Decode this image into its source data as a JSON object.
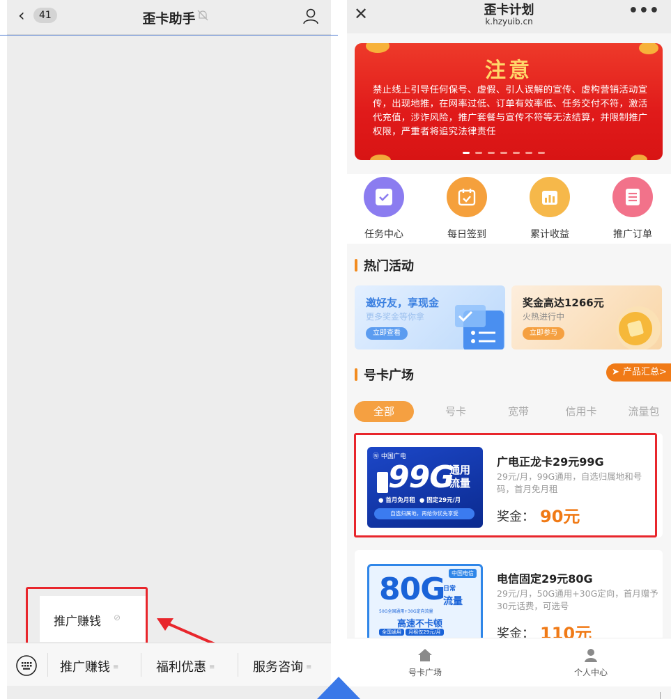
{
  "chat": {
    "back_count": "41",
    "title": "歪卡助手",
    "popup": {
      "label": "推广赚钱",
      "link_icon": "link-icon"
    },
    "menu": [
      {
        "label": "推广赚钱"
      },
      {
        "label": "福利优惠"
      },
      {
        "label": "服务咨询"
      }
    ],
    "menu_lines_glyph": "≡"
  },
  "webview": {
    "title": "歪卡计划",
    "url": "k.hzyuib.cn",
    "banner": {
      "title": "注意",
      "text": "禁止线上引导任何保号、虚假、引人误解的宣传、虚构营销活动宣传，出现地推，在网率过低、订单有效率低、任务交付不符，激活代充值，涉诈风险，推广套餐与宣传不符等无法结算，并限制推广权限，严重者将追究法律责任"
    },
    "quick_actions": [
      {
        "label": "任务中心",
        "icon": "task-icon",
        "color": "#8b7cf0"
      },
      {
        "label": "每日签到",
        "icon": "calendar-icon",
        "color": "#f5a03c"
      },
      {
        "label": "累计收益",
        "icon": "chart-icon",
        "color": "#f6b84a"
      },
      {
        "label": "推广订单",
        "icon": "order-icon",
        "color": "#f2728a"
      }
    ],
    "hot_section_title": "热门活动",
    "promos": [
      {
        "title": "邀好友，享现金",
        "sub": "更多奖金等你拿",
        "button": "立即查看"
      },
      {
        "title": "奖金高达1266元",
        "sub": "火热进行中",
        "button": "立即参与"
      }
    ],
    "card_section_title": "号卡广场",
    "summary_button": "产品汇总>",
    "tabs": [
      "全部",
      "号卡",
      "宽带",
      "信用卡",
      "流量包"
    ],
    "products": [
      {
        "name": "广电正龙卡29元99G",
        "desc": "29元/月，99G通用，自选归属地和号码，首月免月租",
        "bonus_label": "奖金：",
        "bonus": "90元",
        "img": {
          "brand": "Ⓝ 中国广电",
          "big": "99G",
          "side_top": "通用",
          "side_bottom": "流量",
          "badge1": "首月免月租",
          "badge2": "固定29元/月",
          "footer": "自选归属地，再给你优先享受"
        }
      },
      {
        "name": "电信固定29元80G",
        "desc": "29元/月，50G通用+30G定向，首月赠予30元话费，可选号",
        "bonus_label": "奖金：",
        "bonus": "110元",
        "img": {
          "brand": "中国电信",
          "big": "80G",
          "side_top": "日常",
          "side_bottom": "流量",
          "small": "50G全国通用+30G定向流量",
          "slogan": "高速不卡顿",
          "badge1": "全国通用",
          "badge2": "月租仅29元/月"
        }
      }
    ],
    "nav": [
      {
        "label": "号卡广场",
        "icon": "home-icon"
      },
      {
        "label": "个人中心",
        "icon": "person-icon"
      }
    ]
  },
  "colors": {
    "accent_orange": "#f07a16",
    "annotation_red": "#e8262c",
    "banner_red": "#e01a1a"
  }
}
